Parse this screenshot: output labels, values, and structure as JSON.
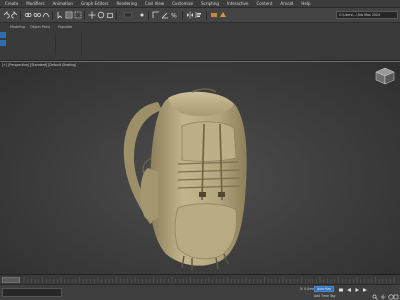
{
  "menu": {
    "items": [
      "Create",
      "Modifiers",
      "Animation",
      "Graph Editors",
      "Rendering",
      "Civil View",
      "Customize",
      "Scripting",
      "Interactive",
      "Content",
      "Arnold",
      "Help"
    ]
  },
  "toolbar": {
    "workspace_field": "C:\\Users\\...\\3ds Max 2024",
    "selection_filter": "All",
    "view_dropdown": "View"
  },
  "ribbon": {
    "tabs": [
      "Modeling",
      "Object Paint",
      "Populate"
    ]
  },
  "viewport": {
    "label": "[+] [Perspective] [Standard] [Default Shading]"
  },
  "status": {
    "autokey_label": "Auto Key",
    "add_time_tag": "Add Time Tag",
    "coord_x": "X: 0.0mm"
  },
  "colors": {
    "accent": "#2c6fb3",
    "fabric": "#b7a981"
  },
  "icons": {
    "toolbar": [
      "undo-icon",
      "redo-icon",
      "link-icon",
      "unlink-icon",
      "bind-icon",
      "select-icon",
      "select-by-name-icon",
      "rect-select-icon",
      "move-icon",
      "rotate-icon",
      "scale-icon",
      "reference-coord-icon",
      "pivot-icon",
      "snap-icon",
      "angle-snap-icon",
      "percent-snap-icon",
      "mirror-icon",
      "align-icon",
      "render-setup-icon",
      "render-icon"
    ],
    "status": [
      "key-mode-icon",
      "play-back-icon",
      "play-icon",
      "play-forward-icon",
      "zoom-icon",
      "pan-icon",
      "orbit-icon",
      "maximize-icon"
    ]
  }
}
